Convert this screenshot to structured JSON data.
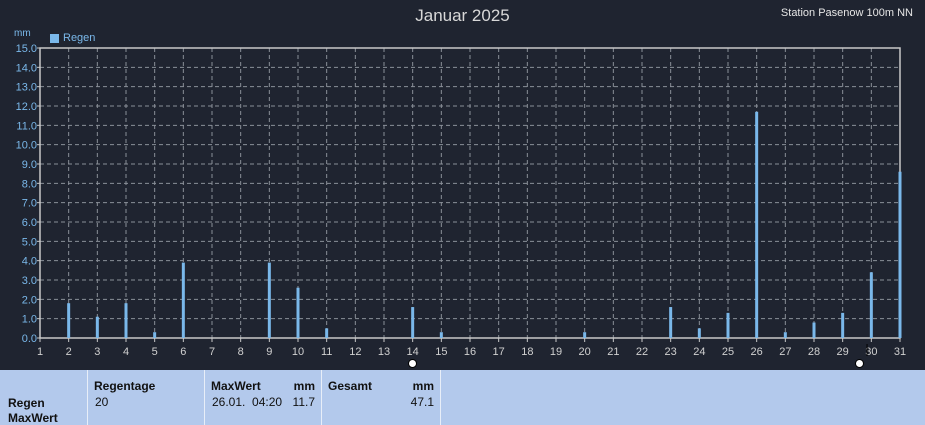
{
  "header": {
    "title": "Januar 2025",
    "station": "Station Pasenow 100m NN",
    "unit": "mm",
    "legend": "Regen"
  },
  "colors": {
    "bar": "#7ab8ea",
    "grid": "#8a8f98",
    "axis": "#c8c8c8",
    "background": "#1f2430"
  },
  "chart_data": {
    "type": "bar",
    "title": "Januar 2025",
    "ylabel": "mm",
    "ylim": [
      0,
      15
    ],
    "y_ticks": [
      "0.0",
      "1.0",
      "2.0",
      "3.0",
      "4.0",
      "5.0",
      "6.0",
      "7.0",
      "8.0",
      "9.0",
      "10.0",
      "11.0",
      "12.0",
      "13.0",
      "14.0",
      "15.0"
    ],
    "x_ticks": [
      "1",
      "2",
      "3",
      "4",
      "5",
      "6",
      "7",
      "8",
      "9",
      "10",
      "11",
      "12",
      "13",
      "14",
      "15",
      "16",
      "17",
      "18",
      "19",
      "20",
      "21",
      "22",
      "23",
      "24",
      "25",
      "26",
      "27",
      "28",
      "29",
      "30",
      "31"
    ],
    "grid": true,
    "legend_position": "top-left",
    "series": [
      {
        "name": "Regen",
        "points": [
          {
            "day": 2,
            "value": 1.8
          },
          {
            "day": 3,
            "value": 1.1
          },
          {
            "day": 4,
            "value": 1.8
          },
          {
            "day": 5,
            "value": 0.3
          },
          {
            "day": 6,
            "value": 3.9
          },
          {
            "day": 9,
            "value": 3.9
          },
          {
            "day": 10,
            "value": 2.6
          },
          {
            "day": 11,
            "value": 0.5
          },
          {
            "day": 14,
            "value": 1.6
          },
          {
            "day": 15,
            "value": 0.3
          },
          {
            "day": 20,
            "value": 0.3
          },
          {
            "day": 23,
            "value": 1.6
          },
          {
            "day": 24,
            "value": 0.5
          },
          {
            "day": 25,
            "value": 1.3
          },
          {
            "day": 26,
            "value": 11.7
          },
          {
            "day": 27,
            "value": 0.3
          },
          {
            "day": 28,
            "value": 0.8
          },
          {
            "day": 29,
            "value": 1.3
          },
          {
            "day": 30,
            "value": 3.4
          },
          {
            "day": 31,
            "value": 8.6
          }
        ]
      }
    ]
  },
  "summary": {
    "label_regen": "Regen",
    "label_maxwert": "MaxWert",
    "regentage_header": "Regentage",
    "regentage_value": "20",
    "maxwert_header": "MaxWert",
    "maxwert_unit": "mm",
    "maxwert_time": "26.01.  04:20",
    "maxwert_value": "11.7",
    "gesamt_header": "Gesamt",
    "gesamt_unit": "mm",
    "gesamt_value": "47.1"
  }
}
